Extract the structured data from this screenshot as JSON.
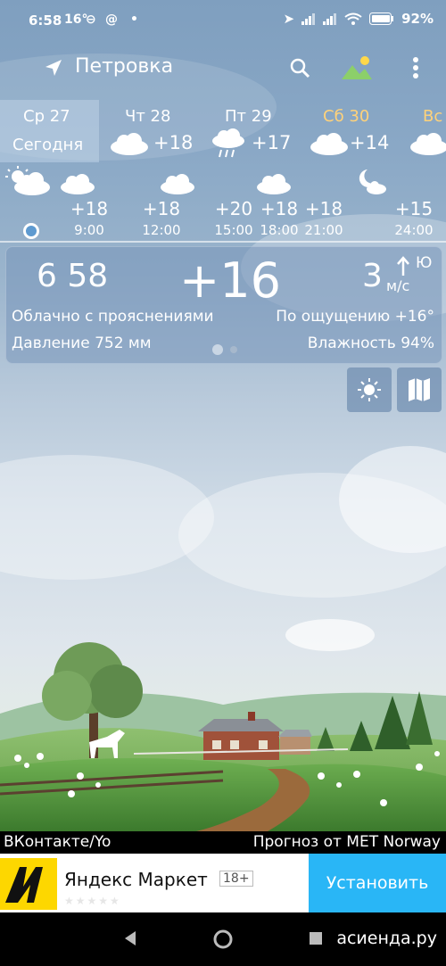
{
  "status": {
    "time": "6:58",
    "temp_small": "16°",
    "battery": "92%"
  },
  "appbar": {
    "city": "Петровка"
  },
  "days": [
    {
      "name": "Ср 27",
      "sub": "Сегодня"
    },
    {
      "name": "Чт 28",
      "temp": "+18",
      "icon": "cloud-icon"
    },
    {
      "name": "Пт 29",
      "temp": "+17",
      "icon": "rain-cloud-icon"
    },
    {
      "name": "Сб 30",
      "temp": "+14",
      "icon": "cloud-icon",
      "color": "#ffd27a"
    },
    {
      "name": "Вс",
      "icon": "cloud-icon",
      "color": "#ffd27a"
    }
  ],
  "hourly": [
    {
      "temp": "+18",
      "hour": "9:00"
    },
    {
      "temp": "+18",
      "hour": "12:00"
    },
    {
      "temp": "+20",
      "hour": "15:00"
    },
    {
      "temp": "+18",
      "hour": "18:00"
    },
    {
      "temp": "+18",
      "hour": "21:00"
    },
    {
      "temp": "+15",
      "hour": "24:00"
    }
  ],
  "current": {
    "clock": "6 58",
    "temp": "+16",
    "wind_speed": "3",
    "wind_dir": "Ю",
    "wind_unit": "м/с",
    "condition": "Облачно с прояснениями",
    "feels": "По ощущению +16°",
    "pressure": "Давление 752 мм",
    "humidity": "Влажность 94%"
  },
  "footer": {
    "left": "ВКонтакте/Yo",
    "right": "Прогноз от MET Norway"
  },
  "ad": {
    "title": "Яндекс Маркет",
    "age": "18+",
    "install": "Установить",
    "stars": "★★★★★"
  },
  "watermark": "асиенда.ру",
  "colors": {
    "accent_weekend": "#ffd27a",
    "install": "#29b6f6",
    "ad_logo": "#fdd700"
  }
}
